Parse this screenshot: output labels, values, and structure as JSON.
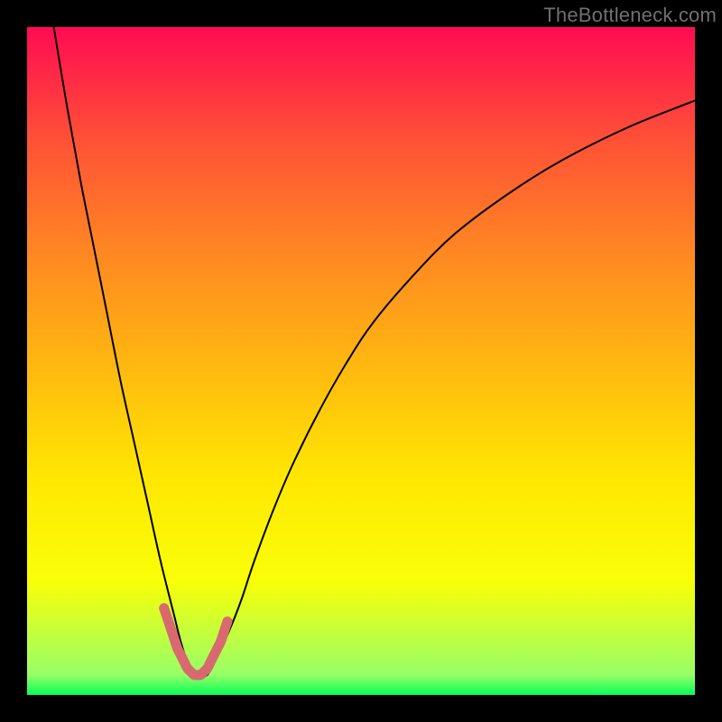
{
  "watermark": "TheBottleneck.com",
  "chart_data": {
    "type": "line",
    "title": "",
    "xlabel": "",
    "ylabel": "",
    "xlim": [
      0,
      100
    ],
    "ylim": [
      0,
      100
    ],
    "gradient_stops": [
      {
        "pct": 0,
        "color": "#ff0b52"
      },
      {
        "pct": 17,
        "color": "#ff5136"
      },
      {
        "pct": 33,
        "color": "#ff8523"
      },
      {
        "pct": 50,
        "color": "#ffb611"
      },
      {
        "pct": 67,
        "color": "#ffe602"
      },
      {
        "pct": 83,
        "color": "#f9ff07"
      },
      {
        "pct": 97,
        "color": "#97ff67"
      },
      {
        "pct": 100,
        "color": "#07ff58"
      }
    ],
    "series": [
      {
        "name": "bottleneck-curve",
        "color": "#000000",
        "x": [
          4,
          6,
          8,
          10,
          12,
          14,
          16,
          18,
          20,
          22,
          23,
          24,
          25,
          26,
          27,
          28,
          30,
          32,
          34,
          37,
          40,
          44,
          48,
          52,
          58,
          64,
          72,
          80,
          90,
          100
        ],
        "y": [
          100,
          88,
          77,
          67,
          57,
          47,
          38,
          29,
          20,
          12,
          8,
          5,
          3,
          3,
          3,
          5,
          9,
          14,
          20,
          28,
          35,
          43,
          50,
          56,
          63,
          69,
          75,
          80,
          85,
          89
        ]
      },
      {
        "name": "highlight-band",
        "color": "#d86a6f",
        "x": [
          20.5,
          21,
          21.5,
          22,
          22.5,
          23,
          23.5,
          24,
          24.5,
          25,
          25.5,
          26,
          26.5,
          27,
          27.5,
          28,
          28.5,
          29,
          29.5,
          30
        ],
        "y": [
          13,
          11.5,
          10,
          8.5,
          7,
          6,
          5,
          4,
          3.5,
          3,
          3,
          3,
          3.5,
          4,
          5,
          6,
          7,
          8,
          9.5,
          11
        ]
      }
    ],
    "flat_baseline_y": 2.5
  }
}
